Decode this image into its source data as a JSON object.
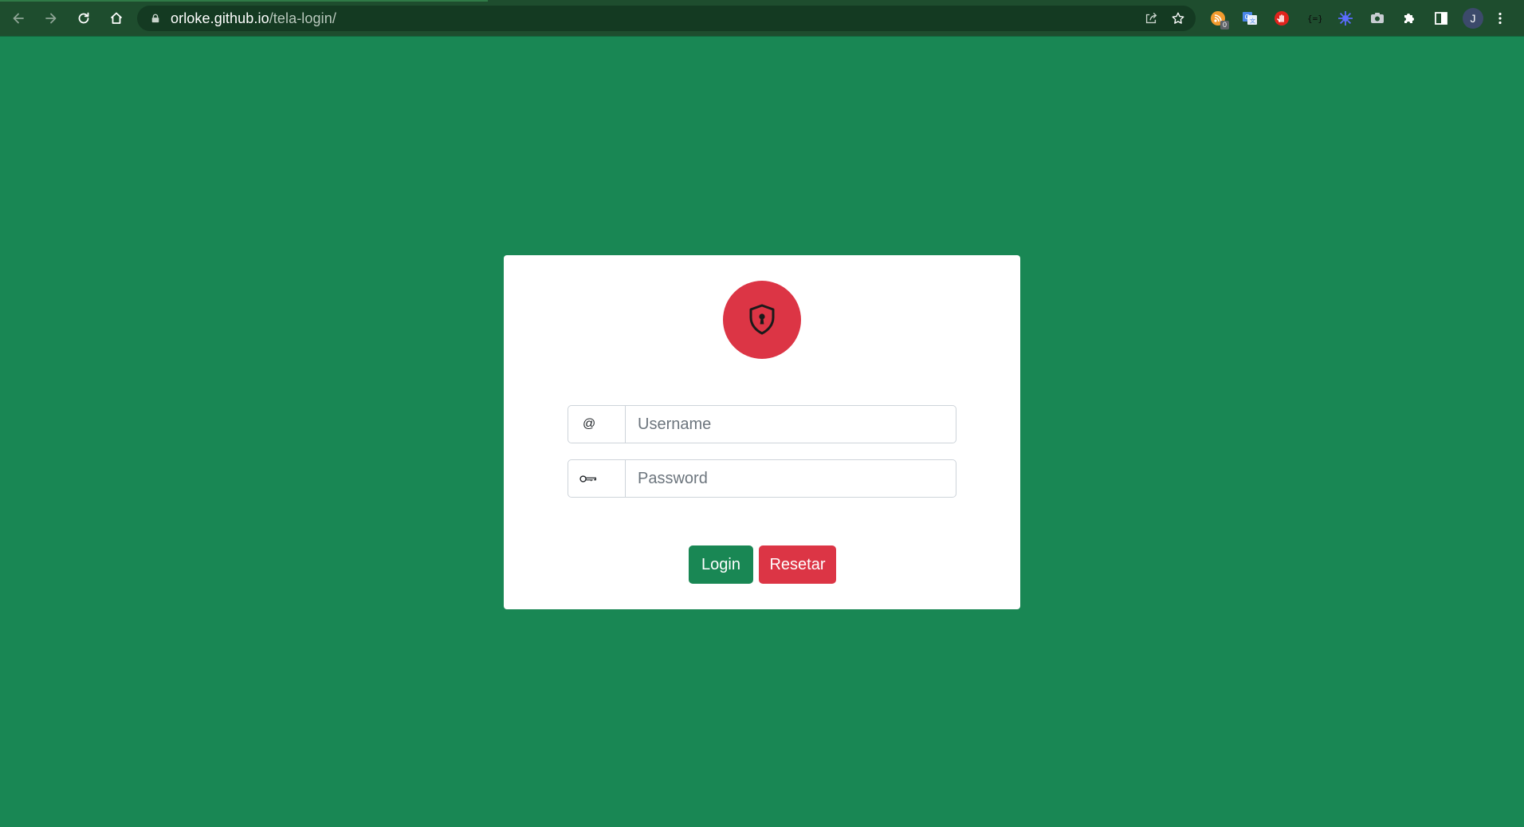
{
  "browser": {
    "url_host": "orloke.github.io",
    "url_path": "/tela-login/",
    "extension_badge": "0",
    "profile_initial": "J"
  },
  "login": {
    "username_placeholder": "Username",
    "password_placeholder": "Password",
    "username_addon": "@",
    "login_label": "Login",
    "reset_label": "Resetar"
  },
  "colors": {
    "page_background": "#198754",
    "primary_button": "#198754",
    "danger_button": "#dc3545",
    "logo_circle": "#dc3545"
  },
  "icons": {
    "logo": "shield-keyhole-icon",
    "password_addon": "key-icon"
  }
}
